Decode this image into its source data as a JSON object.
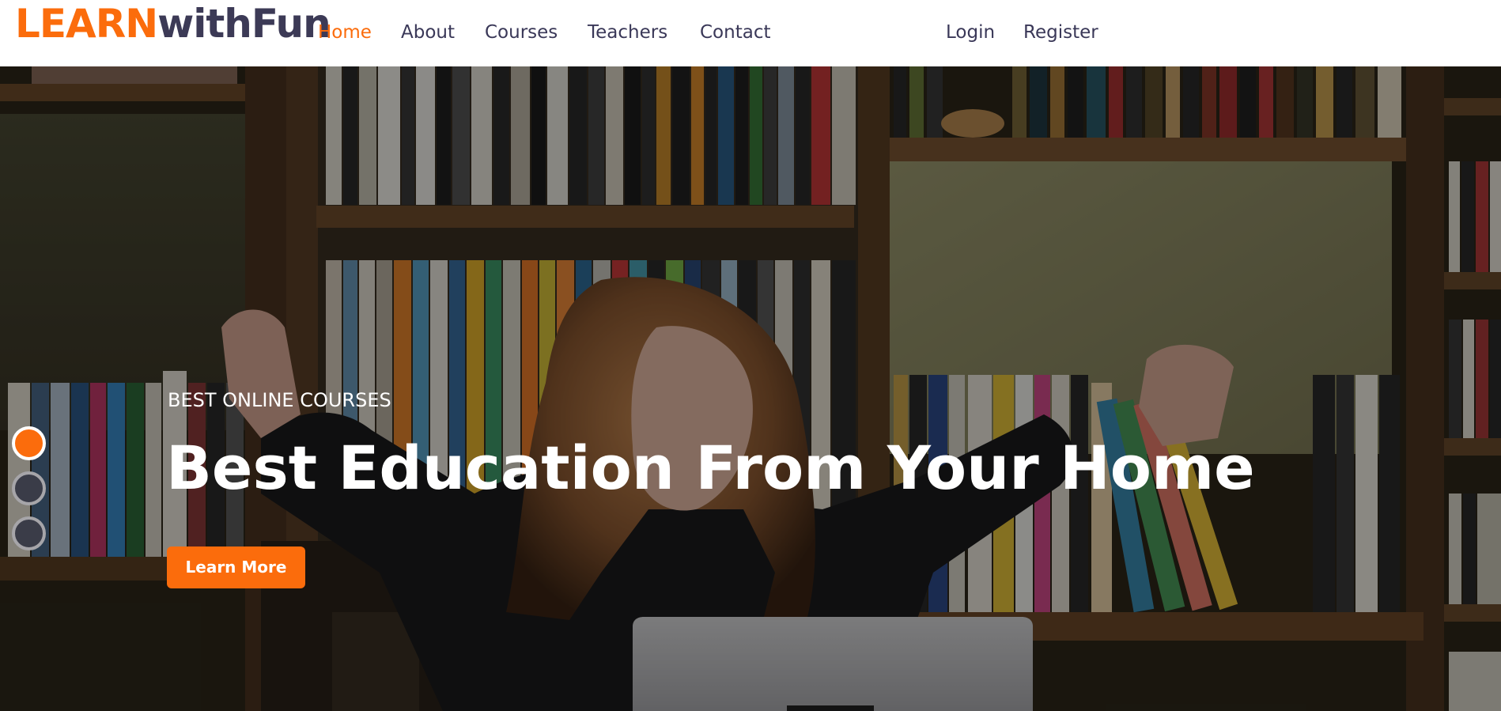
{
  "brand": {
    "part1": "LEARN",
    "part2": "withFun",
    "accent_color": "#fb6c0c",
    "dark_color": "#3c3a56"
  },
  "nav": {
    "items": [
      {
        "label": "Home",
        "active": true
      },
      {
        "label": "About",
        "active": false
      },
      {
        "label": "Courses",
        "active": false
      },
      {
        "label": "Teachers",
        "active": false
      },
      {
        "label": "Contact",
        "active": false
      }
    ],
    "auth": [
      {
        "label": "Login"
      },
      {
        "label": "Register"
      }
    ]
  },
  "hero": {
    "subtitle": "BEST ONLINE COURSES",
    "title": "Best Education From Your Home",
    "button_label": "Learn More",
    "background": "photo-girl-celebrating-in-front-of-bookshelves",
    "slides_total": 3,
    "active_slide": 1
  }
}
